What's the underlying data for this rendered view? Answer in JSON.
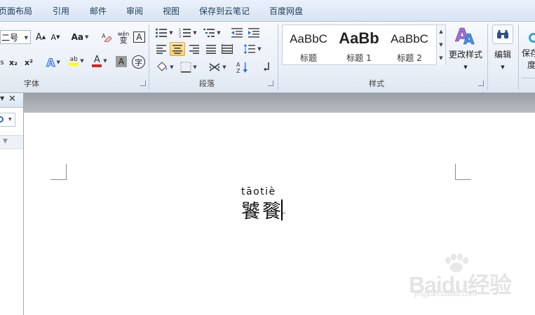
{
  "ribbon_tabs": [
    "页面布局",
    "引用",
    "邮件",
    "审阅",
    "视图",
    "保存到云笔记",
    "百度网盘"
  ],
  "font_group": {
    "size_value": "二号",
    "grow_font": "A",
    "shrink_font": "A",
    "change_case": "Aa",
    "label": "字体",
    "phonetic_top": "wén",
    "phonetic_bottom": "变",
    "char_border": "A",
    "subscript": "x₂",
    "superscript": "x²",
    "text_effect": "A",
    "highlight": "ab",
    "font_color": "A",
    "char_shading": "A",
    "enclose_char": "字"
  },
  "paragraph_group": {
    "label": "段落"
  },
  "styles_group": {
    "label": "样式",
    "items": [
      {
        "sample": "AaBbC",
        "name": "标题"
      },
      {
        "sample": "AaBb",
        "name": "标题 1"
      },
      {
        "sample": "AaBbC",
        "name": "标题 2"
      }
    ],
    "change_styles": "更改样式"
  },
  "editing_group": {
    "label": "编辑"
  },
  "save_group": {
    "label_line1": "保存",
    "label_line2": "度"
  },
  "document": {
    "pinyin": "tāotiè",
    "hanzi": "饕餮"
  },
  "watermark": {
    "brand": "Baidu经验",
    "url": "jingyan.baidu.com"
  },
  "colors": {
    "highlight_yellow": "#ffff00",
    "font_red": "#e02020",
    "accent_blue": "#2a6bd1"
  }
}
